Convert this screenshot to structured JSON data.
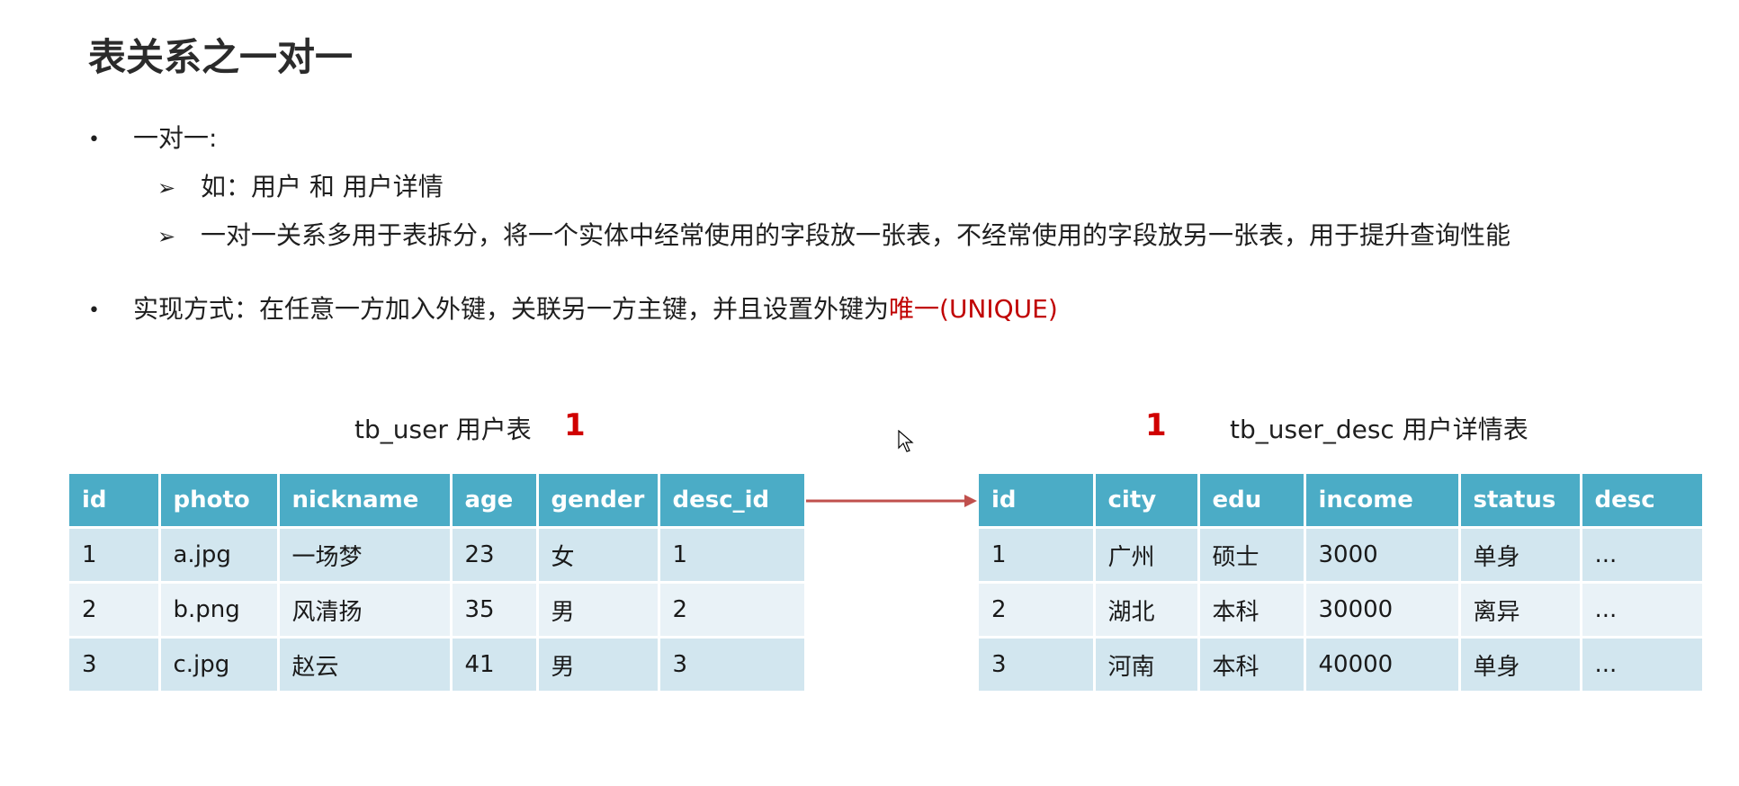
{
  "title": "表关系之一对一",
  "bullets": {
    "b1": "一对一:",
    "sub1": "如：用户 和 用户详情",
    "sub2": "一对一关系多用于表拆分，将一个实体中经常使用的字段放一张表，不经常使用的字段放另一张表，用于提升查询性能",
    "b2_prefix": "实现方式：在任意一方加入外键，关联另一方主键，并且设置外键为",
    "b2_highlight": "唯一(UNIQUE)"
  },
  "left_table": {
    "caption": "tb_user 用户表",
    "cardinality": "1",
    "headers": [
      "id",
      "photo",
      "nickname",
      "age",
      "gender",
      "desc_id"
    ],
    "rows": [
      [
        "1",
        "a.jpg",
        "一场梦",
        "23",
        "女",
        "1"
      ],
      [
        "2",
        "b.png",
        "风清扬",
        "35",
        "男",
        "2"
      ],
      [
        "3",
        "c.jpg",
        "赵云",
        "41",
        "男",
        "3"
      ]
    ]
  },
  "right_table": {
    "caption": "tb_user_desc 用户详情表",
    "cardinality": "1",
    "headers": [
      "id",
      "city",
      "edu",
      "income",
      "status",
      "desc"
    ],
    "rows": [
      [
        "1",
        "广州",
        "硕士",
        "3000",
        "单身",
        "..."
      ],
      [
        "2",
        "湖北",
        "本科",
        "30000",
        "离异",
        "..."
      ],
      [
        "3",
        "河南",
        "本科",
        "40000",
        "单身",
        "..."
      ]
    ]
  },
  "colors": {
    "header": "#4bacc6",
    "row_odd": "#d2e6ef",
    "row_even": "#e9f2f7",
    "highlight": "#c00000",
    "arrow": "#c0504d"
  }
}
